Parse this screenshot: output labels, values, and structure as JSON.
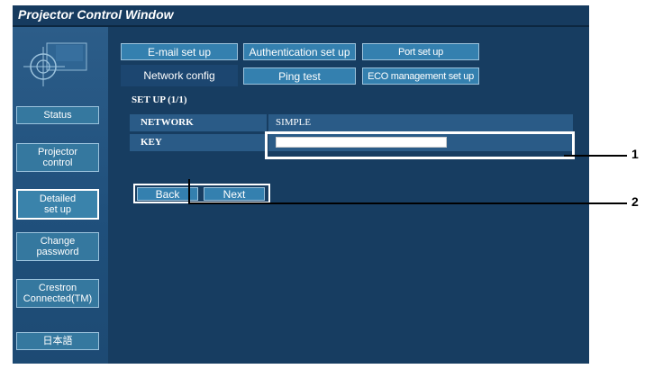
{
  "window": {
    "title": "Projector Control Window"
  },
  "sidebar": {
    "items": [
      {
        "label": "Status"
      },
      {
        "label": "Projector\ncontrol"
      },
      {
        "label": "Detailed\nset up",
        "active": true
      },
      {
        "label": "Change\npassword"
      },
      {
        "label": "Crestron\nConnected(TM)"
      },
      {
        "label": "日本語"
      }
    ]
  },
  "tabs": {
    "top_row": [
      "E-mail set up",
      "Authentication set up",
      "Port set up"
    ],
    "bottom_row": [
      "Network config",
      "Ping test",
      "ECO management set up"
    ],
    "selected": "Network config"
  },
  "setup": {
    "title": "SET UP (1/1)",
    "rows": [
      {
        "label": "NETWORK",
        "value": "SIMPLE"
      },
      {
        "label": "KEY",
        "value": ""
      }
    ]
  },
  "nav": {
    "back": "Back",
    "next": "Next"
  },
  "callouts": [
    "1",
    "2"
  ],
  "colors": {
    "window_bg": "#163b5f",
    "button_bg": "#3480af",
    "row_bg": "#2a5b87"
  }
}
